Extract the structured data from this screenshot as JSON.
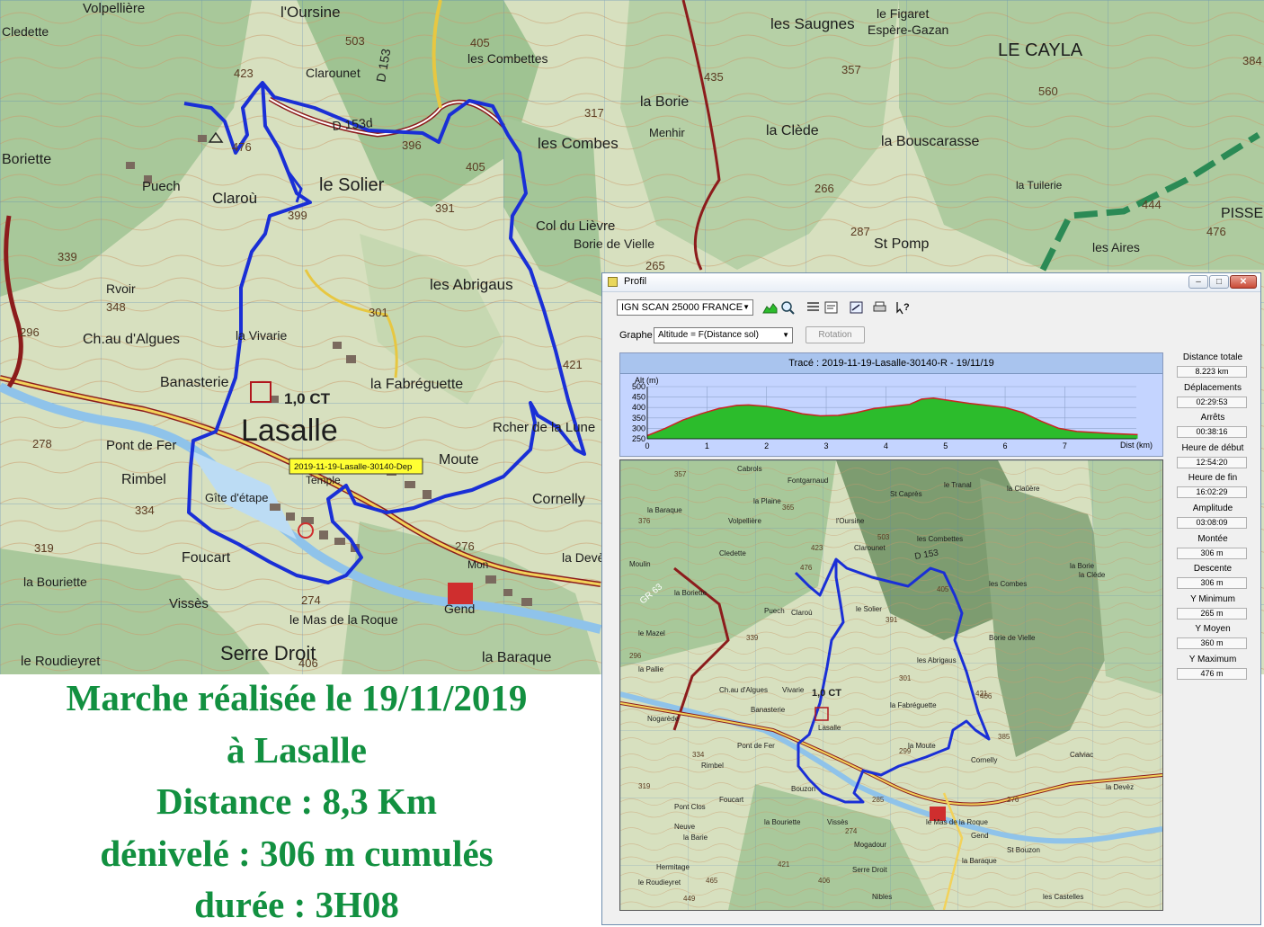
{
  "caption": {
    "line1": "Marche réalisée le 19/11/2019",
    "line2": "à Lasalle",
    "line3": "Distance : 8,3 Km",
    "line4": "dénivelé : 306 m cumulés",
    "line5": "durée : 3H08"
  },
  "map": {
    "places": [
      "Volpellière",
      "Cledette",
      "l'Oursine",
      "Clarounet",
      "les Combettes",
      "les Saugnes",
      "le Figaret",
      "Espère-Gazan",
      "LE CAYLA",
      "la Borie",
      "Menhir",
      "la Clède",
      "la Bouscarasse",
      "les Combes",
      "le Solier",
      "Claroù",
      "Boriette",
      "Puech",
      "Col du Lièvre",
      "Borie de Vielle",
      "St Pomp",
      "les Aires",
      "PISSE",
      "la Tuilerie",
      "les Abrigaus",
      "la Vivarie",
      "Ch.au d'Algues",
      "Banasterie",
      "la Fabréguette",
      "Lasalle",
      "Rcher de la Lune",
      "Moute",
      "Cornelly",
      "Pont de Fer",
      "Rimbel",
      "Foucart",
      "la Bouriette",
      "Vissès",
      "le Mas de la Roque",
      "Gend",
      "Serre Droit",
      "le Roudieyret",
      "la Baraque",
      "la Devèz",
      "Mon",
      "Rvoir",
      "Gîte d'étape",
      "Temple"
    ],
    "spot_heights": [
      "503",
      "405",
      "423",
      "476",
      "399",
      "396",
      "391",
      "405",
      "317",
      "435",
      "357",
      "560",
      "384",
      "266",
      "287",
      "444",
      "476",
      "339",
      "348",
      "296",
      "301",
      "421",
      "278",
      "274",
      "276",
      "334",
      "319",
      "406",
      "265"
    ],
    "grid_ref": "1,0 CT",
    "road": "D 153",
    "road_d": "D 153d",
    "marker_label": "2019-11-19-Lasalle-30140-Dep"
  },
  "window": {
    "title": "Profil",
    "map_source": "IGN SCAN 25000 FRANCE",
    "graph_label": "Graphe",
    "graph_select": "Altitude = F(Distance sol)",
    "rotation_label": "Rotation",
    "profile_title": "Tracé : 2019-11-19-Lasalle-30140-R - 19/11/19",
    "y_axis_label": "Alt (m)",
    "x_axis_label": "Dist (km)",
    "inset_places": [
      "Cabrols",
      "Fontgarnaud",
      "la Plaine",
      "St Caprès",
      "le Tranal",
      "la Claûère",
      "la Baraque",
      "Volpellière",
      "l'Oursine",
      "Clarounet",
      "les Combettes",
      "Cledette",
      "Moulin",
      "la Borie",
      "les Combes",
      "la Clède",
      "la Boriette",
      "Puech",
      "Claroù",
      "le Solier",
      "Borie de Vielle",
      "le Mazel",
      "la Pallie",
      "les Abrigaus",
      "Ch.au d'Algues",
      "Vivarie",
      "Banasterie",
      "la Fabréguette",
      "Lasalle",
      "la Moute",
      "Cornelly",
      "Calviac",
      "Nogarède",
      "Pont de Fer",
      "Rimbel",
      "Bouzon",
      "Foucart",
      "la Bouriette",
      "Vissès",
      "le Mas de la Roque",
      "Gend",
      "la Devèz",
      "Mogadour",
      "Serre Droit",
      "Hermitage",
      "la Baraque",
      "St Bouzon",
      "le Roudieyret",
      "Pont Clos",
      "Neuve",
      "la Barie",
      "Nibles",
      "les Castelles"
    ],
    "inset_heights": [
      "357",
      "365",
      "376",
      "503",
      "405",
      "423",
      "476",
      "339",
      "391",
      "301",
      "421",
      "296",
      "299",
      "385",
      "406",
      "274",
      "285",
      "421",
      "449",
      "465",
      "406",
      "276",
      "334",
      "319"
    ],
    "inset_grid_ref": "1,0 CT",
    "inset_roads": [
      "GR 63",
      "D 153"
    ]
  },
  "stats": [
    {
      "label": "Distance totale",
      "value": "8.223 km"
    },
    {
      "label": "Déplacements",
      "value": "02:29:53"
    },
    {
      "label": "Arrêts",
      "value": "00:38:16"
    },
    {
      "label": "Heure de début",
      "value": "12:54:20"
    },
    {
      "label": "Heure de fin",
      "value": "16:02:29"
    },
    {
      "label": "Amplitude",
      "value": "03:08:09"
    },
    {
      "label": "Montée",
      "value": "306 m"
    },
    {
      "label": "Descente",
      "value": "306 m"
    },
    {
      "label": "Y Minimum",
      "value": "265 m"
    },
    {
      "label": "Y Moyen",
      "value": "360 m"
    },
    {
      "label": "Y Maximum",
      "value": "476 m"
    }
  ],
  "chart_data": {
    "type": "area",
    "title": "Tracé : 2019-11-19-Lasalle-30140-R - 19/11/19",
    "xlabel": "Dist (km)",
    "ylabel": "Alt (m)",
    "xlim": [
      0,
      8.2
    ],
    "ylim": [
      250,
      500
    ],
    "x_ticks": [
      "0",
      "1",
      "2",
      "3",
      "4",
      "5",
      "6",
      "7"
    ],
    "y_ticks": [
      "500",
      "450",
      "400",
      "350",
      "300",
      "250"
    ],
    "series": [
      {
        "x": [
          0,
          0.3,
          0.6,
          0.9,
          1.2,
          1.5,
          1.7,
          2.0,
          2.3,
          2.6,
          2.9,
          3.2,
          3.5,
          3.8,
          4.1,
          4.4,
          4.6,
          4.8,
          5.1,
          5.4,
          5.7,
          6.0,
          6.3,
          6.6,
          6.9,
          7.2,
          7.5,
          7.8,
          8.223
        ],
        "y": [
          265,
          300,
          340,
          370,
          395,
          410,
          412,
          405,
          390,
          370,
          360,
          362,
          375,
          395,
          405,
          415,
          440,
          445,
          432,
          420,
          410,
          400,
          375,
          335,
          300,
          285,
          280,
          275,
          270
        ]
      }
    ],
    "colors": {
      "fill": "#2cbc2c",
      "line": "#cc2222",
      "background": "#c4d4ff"
    }
  },
  "colors": {
    "caption": "#129040",
    "track": "#1a2fd6",
    "marker_bg": "#ffff33"
  }
}
